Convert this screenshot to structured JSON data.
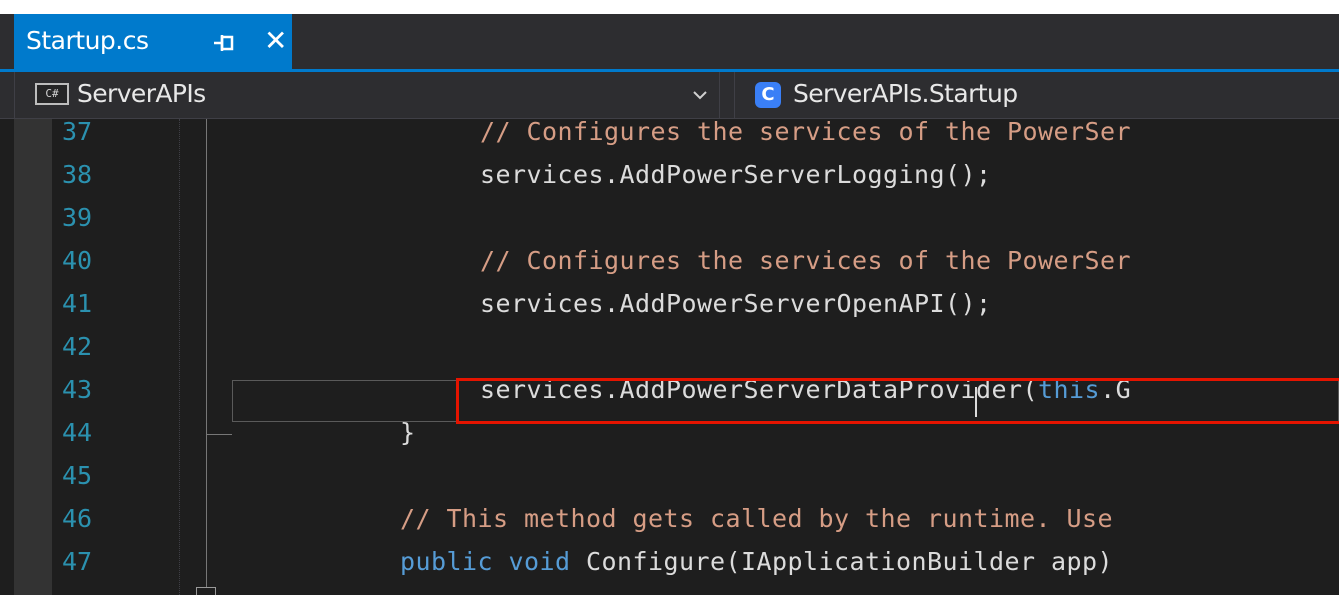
{
  "tab": {
    "title": "Startup.cs",
    "pin_icon": "pin-icon",
    "close_icon": "close-icon",
    "close_glyph": "✕"
  },
  "navbar": {
    "project": {
      "icon_text": "C#",
      "label": "ServerAPIs",
      "icon": "csharp-project-icon",
      "dropdown_icon": "chevron-down-icon"
    },
    "class": {
      "icon_text": "C",
      "label": "ServerAPIs.Startup",
      "icon": "class-icon"
    }
  },
  "lines": [
    {
      "number": "37",
      "indent": 480,
      "text": "// Configures the services of the PowerSer",
      "kind": "comment"
    },
    {
      "number": "38",
      "indent": 480,
      "text": "services.AddPowerServerLogging();",
      "kind": "code"
    },
    {
      "number": "39",
      "indent": 480,
      "text": "",
      "kind": "code"
    },
    {
      "number": "40",
      "indent": 480,
      "text": "// Configures the services of the PowerSer",
      "kind": "comment"
    },
    {
      "number": "41",
      "indent": 480,
      "text": "services.AddPowerServerOpenAPI();",
      "kind": "code"
    },
    {
      "number": "42",
      "indent": 480,
      "text": "",
      "kind": "code"
    },
    {
      "number": "43",
      "indent": 480,
      "text_before": "services.AddPowerServerDataProvider(",
      "keyword": "this",
      "text_after": ".G",
      "kind": "mixed"
    },
    {
      "number": "44",
      "indent": 400,
      "text": "}",
      "kind": "code"
    },
    {
      "number": "45",
      "indent": 400,
      "text": "",
      "kind": "code"
    },
    {
      "number": "46",
      "indent": 400,
      "text": "// This method gets called by the runtime. Use",
      "kind": "comment"
    },
    {
      "number": "47",
      "indent": 400,
      "text_before": "",
      "keyword": "public void",
      "text_after": " Configure(IApplicationBuilder app)",
      "kind": "mixed"
    }
  ],
  "colors": {
    "accent": "#007acc",
    "line_number": "#2b91af",
    "comment": "#d69d85",
    "keyword": "#569cd6",
    "highlight_box": "#e51400"
  }
}
